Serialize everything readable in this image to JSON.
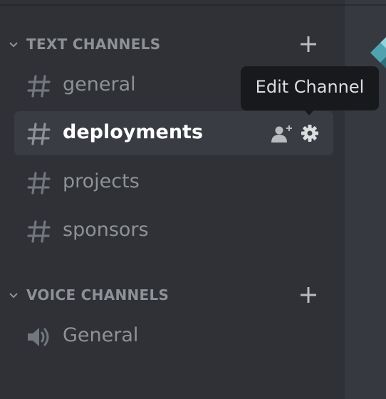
{
  "sidebar": {
    "text_category": {
      "label": "TEXT CHANNELS",
      "icon": "plus-icon"
    },
    "text_channels": [
      {
        "label": "general",
        "icon": "hash-icon",
        "selected": false
      },
      {
        "label": "deployments",
        "icon": "hash-icon",
        "selected": true
      },
      {
        "label": "projects",
        "icon": "hash-icon",
        "selected": false
      },
      {
        "label": "sponsors",
        "icon": "hash-icon",
        "selected": false
      }
    ],
    "voice_category": {
      "label": "VOICE CHANNELS",
      "icon": "plus-icon"
    },
    "voice_channels": [
      {
        "label": "General",
        "icon": "speaker-icon"
      }
    ]
  },
  "tooltip": {
    "text": "Edit Channel"
  },
  "colors": {
    "sidebar_bg": "#2f3136",
    "chat_bg": "#36393f",
    "selected_bg": "#393c43",
    "muted_text": "#8e9297",
    "active_text": "#ffffff",
    "tooltip_bg": "#18191c",
    "logo_teal": "#5fb8c4"
  }
}
